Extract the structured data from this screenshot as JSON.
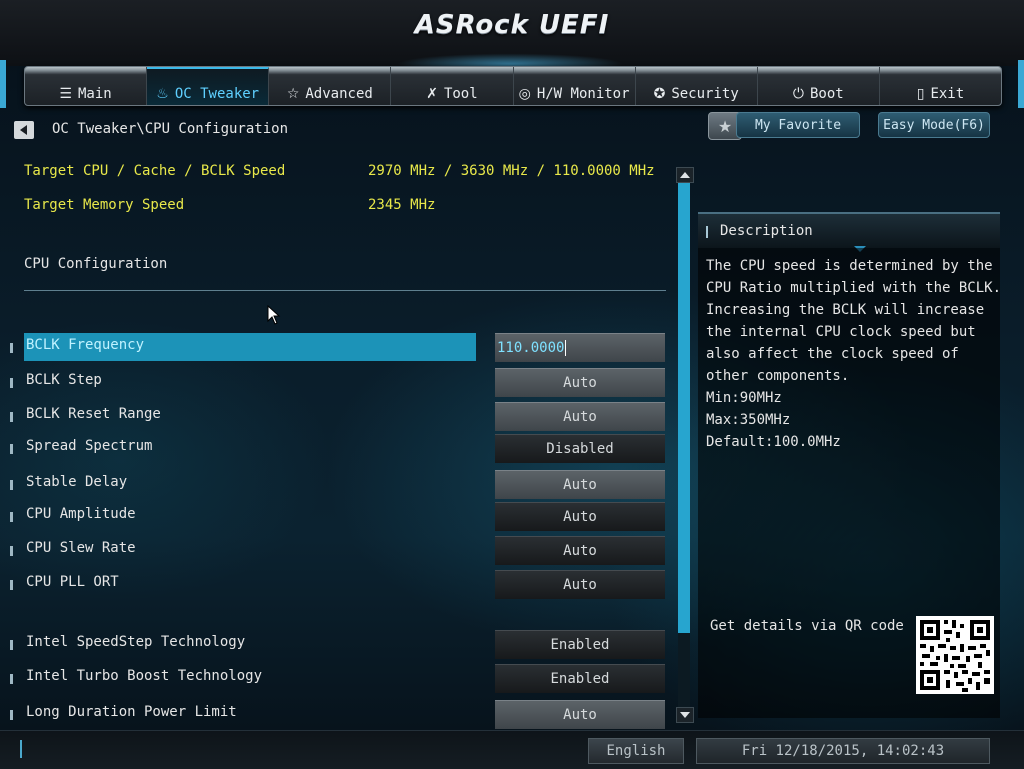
{
  "app": {
    "title": "ASRock UEFI"
  },
  "nav": {
    "items": [
      {
        "label": "Main",
        "icon": "list-icon",
        "glyph": "☰"
      },
      {
        "label": "OC Tweaker",
        "icon": "flame-icon",
        "glyph": "♨",
        "active": true
      },
      {
        "label": "Advanced",
        "icon": "star-icon",
        "glyph": "☆"
      },
      {
        "label": "Tool",
        "icon": "tools-icon",
        "glyph": "✗"
      },
      {
        "label": "H/W Monitor",
        "icon": "monitor-icon",
        "glyph": "◎"
      },
      {
        "label": "Security",
        "icon": "shield-icon",
        "glyph": "✪"
      },
      {
        "label": "Boot",
        "icon": "power-icon",
        "glyph": "⏻"
      },
      {
        "label": "Exit",
        "icon": "exit-icon",
        "glyph": "▯"
      }
    ]
  },
  "breadcrumb": "OC Tweaker\\CPU Configuration",
  "favorite": {
    "label": "My Favorite"
  },
  "easy_mode": {
    "label": "Easy Mode(F6)"
  },
  "info": {
    "target_cpu_label": "Target CPU / Cache / BCLK Speed",
    "target_cpu_value": "2970 MHz / 3630 MHz / 110.0000 MHz",
    "target_mem_label": "Target Memory Speed",
    "target_mem_value": "2345 MHz"
  },
  "section_title": "CPU Configuration",
  "settings": [
    {
      "label": "BCLK Frequency",
      "value": "110.0000",
      "kind": "input",
      "selected": true
    },
    {
      "label": "BCLK Step",
      "value": "Auto",
      "kind": "auto-light"
    },
    {
      "label": "BCLK Reset Range",
      "value": "Auto",
      "kind": "auto-light"
    },
    {
      "label": "Spread Spectrum",
      "value": "Disabled",
      "kind": "dark"
    },
    {
      "label": "Stable Delay",
      "value": "Auto",
      "kind": "auto-light"
    },
    {
      "label": "CPU Amplitude",
      "value": "Auto",
      "kind": "dark"
    },
    {
      "label": "CPU Slew Rate",
      "value": "Auto",
      "kind": "dark"
    },
    {
      "label": "CPU PLL ORT",
      "value": "Auto",
      "kind": "dark"
    },
    {
      "label": "Intel SpeedStep Technology",
      "value": "Enabled",
      "kind": "dark"
    },
    {
      "label": "Intel Turbo Boost Technology",
      "value": "Enabled",
      "kind": "dark"
    },
    {
      "label": "Long Duration Power Limit",
      "value": "Auto",
      "kind": "auto-light"
    }
  ],
  "description": {
    "title": "Description",
    "lines": [
      "The CPU speed is determined by the",
      "CPU Ratio multiplied with the BCLK.",
      "Increasing the BCLK will increase",
      "the internal CPU clock speed but",
      "also affect the clock speed of",
      "other components.",
      "Min:90MHz",
      "Max:350MHz",
      "Default:100.0MHz"
    ],
    "qr_label": "Get details via QR code"
  },
  "status": {
    "language": "English",
    "datetime": "Fri 12/18/2015, 14:02:43"
  },
  "colors": {
    "accent": "#1c93b8",
    "info_text": "#e8e84a",
    "active_tab": "#5fd0ff"
  }
}
